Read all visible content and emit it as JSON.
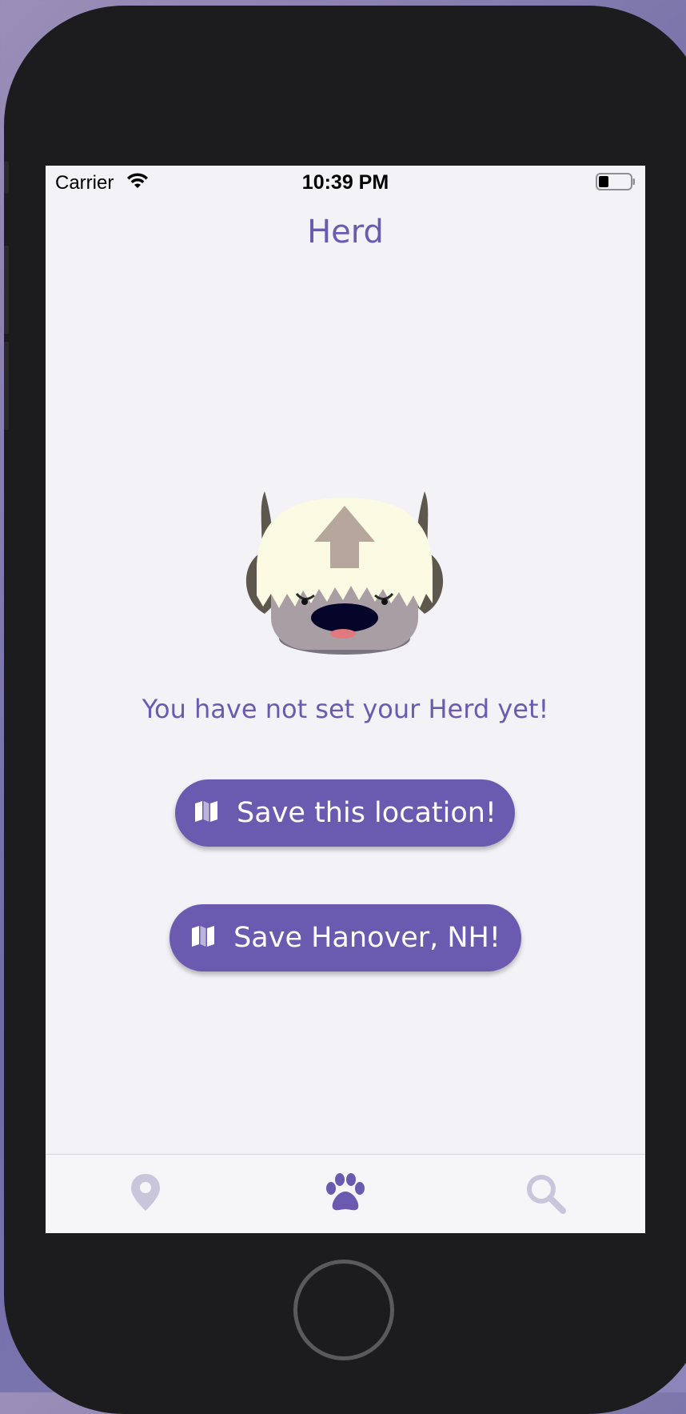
{
  "status_bar": {
    "carrier": "Carrier",
    "time": "10:39 PM"
  },
  "nav": {
    "title": "Herd"
  },
  "main": {
    "empty_message": "You have not set your Herd yet!",
    "save_location_label": "Save this location!",
    "save_hanover_label": "Save Hanover, NH!"
  },
  "tab_bar": {
    "tabs": [
      {
        "icon": "location-pin-icon",
        "active": false
      },
      {
        "icon": "paw-icon",
        "active": true
      },
      {
        "icon": "search-icon",
        "active": false
      }
    ]
  },
  "colors": {
    "accent": "#6a5bb0",
    "inactive_tab": "#c9c6dc",
    "background": "#f2f2f7"
  }
}
